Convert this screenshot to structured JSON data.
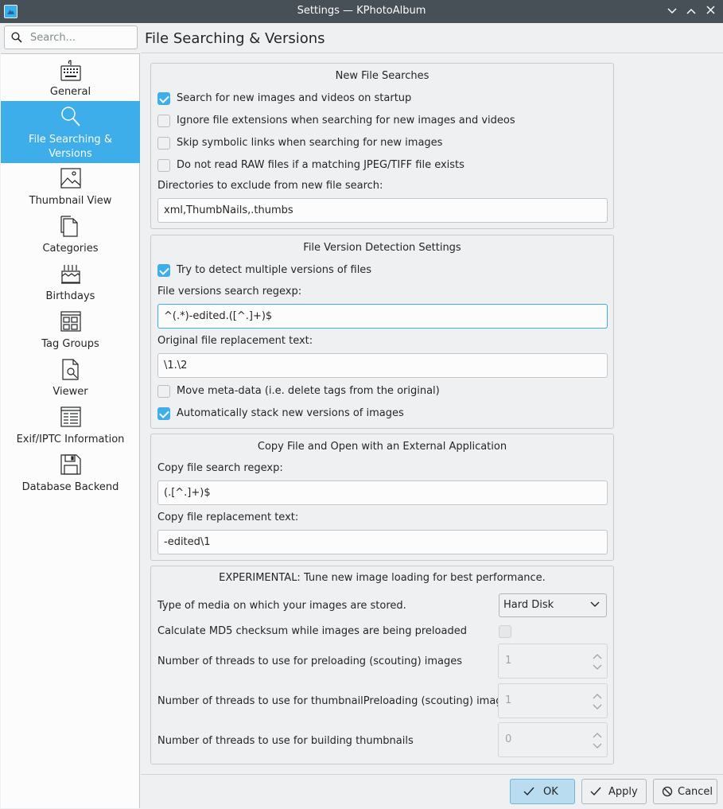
{
  "window": {
    "title": "Settings — KPhotoAlbum"
  },
  "search": {
    "placeholder": "Search..."
  },
  "page": {
    "title": "File Searching & Versions"
  },
  "sidebar": {
    "items": [
      {
        "label": "General",
        "icon": "keyboard-icon"
      },
      {
        "label": "File Searching &",
        "label2": "Versions",
        "icon": "search-icon",
        "active": true
      },
      {
        "label": "Thumbnail View",
        "icon": "image-icon"
      },
      {
        "label": "Categories",
        "icon": "copy-icon"
      },
      {
        "label": "Birthdays",
        "icon": "cake-icon"
      },
      {
        "label": "Tag Groups",
        "icon": "grid-icon"
      },
      {
        "label": "Viewer",
        "icon": "document-search-icon"
      },
      {
        "label": "Exif/IPTC Information",
        "icon": "table-icon"
      },
      {
        "label": "Database Backend",
        "icon": "floppy-icon"
      }
    ]
  },
  "new_search": {
    "title": "New File Searches",
    "opt_startup": "Search for new images and videos on startup",
    "opt_ignore_ext": "Ignore file extensions when searching for new images and videos",
    "opt_skip_symlinks": "Skip symbolic links when searching for new images",
    "opt_raw": "Do not read RAW files if a matching JPEG/TIFF file exists",
    "exclude_label": "Directories to exclude from new file search:",
    "exclude_value": "xml,ThumbNails,.thumbs"
  },
  "versions": {
    "title": "File Version Detection Settings",
    "opt_detect": "Try to detect multiple versions of files",
    "regexp_label": "File versions search regexp:",
    "regexp_value": "^(.*)-edited.([^.]+)$",
    "replace_label": "Original file replacement text:",
    "replace_value": "\\1.\\2",
    "opt_move_meta": "Move meta-data (i.e. delete tags from the original)",
    "opt_stack": "Automatically stack new versions of images"
  },
  "copy_open": {
    "title": "Copy File and Open with an External Application",
    "regexp_label": "Copy file search regexp:",
    "regexp_value": "(.[^.]+)$",
    "replace_label": "Copy file replacement text:",
    "replace_value": "-edited\\1"
  },
  "experimental": {
    "title": "EXPERIMENTAL: Tune new image loading for best performance.",
    "media_label": "Type of media on which your images are stored.",
    "media_value": "Hard Disk",
    "md5_label": "Calculate MD5 checksum while images are being preloaded",
    "threads_preload_label": "Number of threads to use for preloading (scouting) images",
    "threads_preload_value": "1",
    "threads_thumbpre_label": "Number of threads to use for thumbnailPreloading (scouting) images",
    "threads_thumbpre_value": "1",
    "threads_build_label": "Number of threads to use for building thumbnails",
    "threads_build_value": "0"
  },
  "buttons": {
    "ok": "OK",
    "apply": "Apply",
    "cancel": "Cancel"
  },
  "colors": {
    "accent": "#3daee9",
    "titlebar": "#475057",
    "window_bg": "#eff0f1"
  }
}
